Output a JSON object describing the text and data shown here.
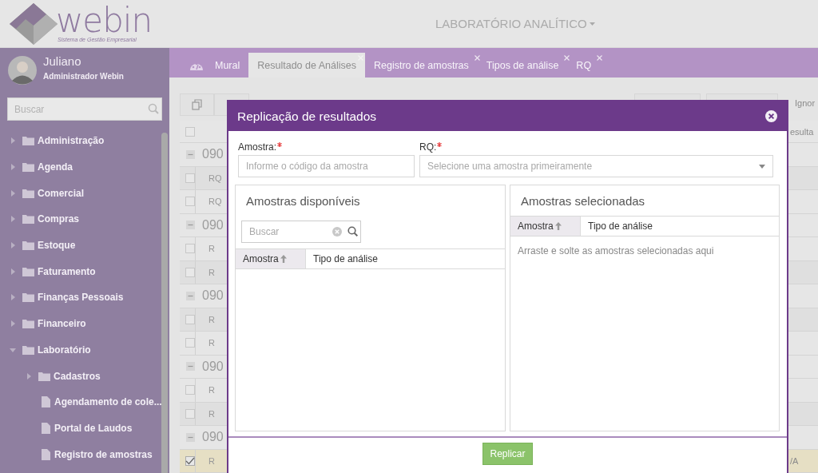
{
  "header": {
    "logo": {
      "name": "webin",
      "tagline": "Sistema de Gestão Empresarial"
    },
    "module": "LABORATÓRIO ANALÍTICO"
  },
  "user": {
    "name": "Juliano",
    "role": "Administrador Webin"
  },
  "sidebar": {
    "search": {
      "placeholder": "Buscar"
    },
    "items": [
      {
        "label": "Administração",
        "kind": "folder",
        "expanded": false
      },
      {
        "label": "Agenda",
        "kind": "folder",
        "expanded": false
      },
      {
        "label": "Comercial",
        "kind": "folder",
        "expanded": false
      },
      {
        "label": "Compras",
        "kind": "folder",
        "expanded": false
      },
      {
        "label": "Estoque",
        "kind": "folder",
        "expanded": false
      },
      {
        "label": "Faturamento",
        "kind": "folder",
        "expanded": false
      },
      {
        "label": "Finanças Pessoais",
        "kind": "folder",
        "expanded": false
      },
      {
        "label": "Financeiro",
        "kind": "folder",
        "expanded": false
      },
      {
        "label": "Laboratório",
        "kind": "folder",
        "expanded": true,
        "children": [
          {
            "label": "Cadastros",
            "kind": "folder",
            "expanded": false
          },
          {
            "label": "Agendamento de cole...",
            "kind": "page"
          },
          {
            "label": "Portal de Laudos",
            "kind": "page"
          },
          {
            "label": "Registro de amostras",
            "kind": "page"
          }
        ]
      }
    ]
  },
  "tabs": [
    {
      "label": "Mural",
      "selected": false,
      "closable": false,
      "kind": "dashboard"
    },
    {
      "label": "Resultado de Análises",
      "selected": true,
      "closable": true,
      "kind": "plain"
    },
    {
      "label": "Registro de amostras",
      "selected": false,
      "closable": true,
      "kind": "plain"
    },
    {
      "label": "Tipos de análise",
      "selected": false,
      "closable": true,
      "kind": "plain"
    },
    {
      "label": "RQ",
      "selected": false,
      "closable": true,
      "kind": "plain"
    }
  ],
  "grid": {
    "toolbar_label": "Ignor",
    "column_header": "esulta",
    "header_checked": false,
    "rows": [
      {
        "kind": "group",
        "text": "090"
      },
      {
        "kind": "item",
        "text": "RQ",
        "checked": false
      },
      {
        "kind": "item",
        "text": "RQ",
        "checked": false
      },
      {
        "kind": "group",
        "text": "090"
      },
      {
        "kind": "item",
        "text": "R",
        "checked": false
      },
      {
        "kind": "item",
        "text": "R",
        "checked": false
      },
      {
        "kind": "group",
        "text": "090"
      },
      {
        "kind": "item",
        "text": "R",
        "checked": false
      },
      {
        "kind": "item",
        "text": "R",
        "checked": false
      },
      {
        "kind": "group",
        "text": "090"
      },
      {
        "kind": "item",
        "text": "R",
        "checked": false
      },
      {
        "kind": "item",
        "text": "R",
        "checked": false
      },
      {
        "kind": "group",
        "text": "090"
      },
      {
        "kind": "item",
        "text": "R",
        "checked": true,
        "end_text": "/A"
      }
    ]
  },
  "dialog": {
    "title": "Replicação de resultados",
    "fields": [
      {
        "label": "Amostra:",
        "required": true,
        "kind": "text",
        "placeholder": "Informe o código da amostra"
      },
      {
        "label": "RQ:",
        "required": true,
        "kind": "select",
        "placeholder": "Selecione uma amostra primeiramente"
      }
    ],
    "available": {
      "title": "Amostras disponíveis",
      "search": {
        "placeholder": "Buscar"
      },
      "columns": [
        {
          "label": "Amostra",
          "sorted": true
        },
        {
          "label": "Tipo de análise",
          "sorted": false
        }
      ]
    },
    "selected": {
      "title": "Amostras selecionadas",
      "columns": [
        {
          "label": "Amostra",
          "sorted": true
        },
        {
          "label": "Tipo de análise",
          "sorted": false
        }
      ],
      "empty_text": "Arraste e solte as amostras selecionadas aqui"
    },
    "button": "Replicar"
  }
}
